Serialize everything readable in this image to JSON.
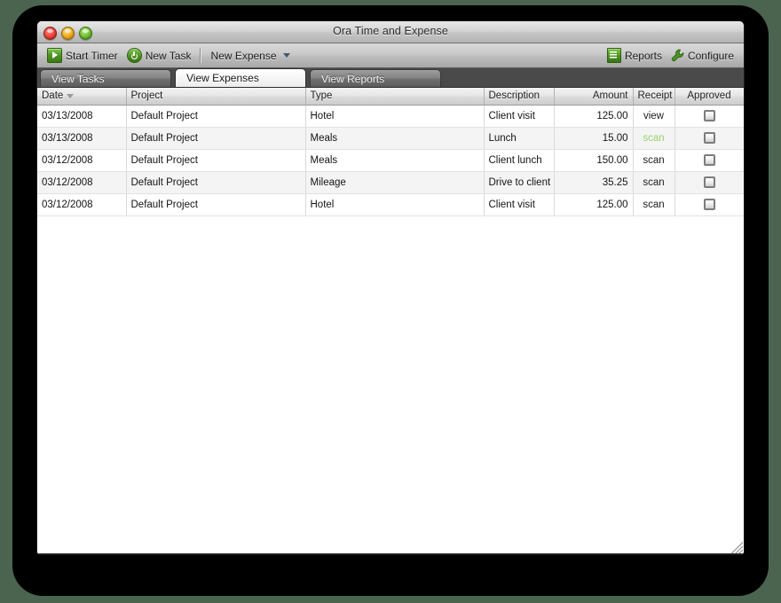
{
  "window": {
    "title": "Ora Time and Expense",
    "controls": [
      {
        "name": "close",
        "color": "#e8433a"
      },
      {
        "name": "minimize",
        "color": "#f0a81e"
      },
      {
        "name": "zoom",
        "color": "#6cbb32"
      }
    ]
  },
  "toolbar": {
    "start_timer_label": "Start Timer",
    "new_task_label": "New Task",
    "new_expense_label": "New Expense",
    "reports_label": "Reports",
    "configure_label": "Configure"
  },
  "tabs": [
    {
      "label": "View Tasks",
      "active": false
    },
    {
      "label": "View Expenses",
      "active": true
    },
    {
      "label": "View Reports",
      "active": false
    }
  ],
  "table": {
    "sort_column": "Date",
    "sort_direction": "descending",
    "columns": [
      {
        "label": "Date",
        "align": "left"
      },
      {
        "label": "Project",
        "align": "left"
      },
      {
        "label": "Type",
        "align": "left"
      },
      {
        "label": "Description",
        "align": "left"
      },
      {
        "label": "Amount",
        "align": "right"
      },
      {
        "label": "Receipt",
        "align": "center"
      },
      {
        "label": "Approved",
        "align": "center"
      }
    ],
    "rows": [
      {
        "date": "03/13/2008",
        "project": "Default Project",
        "type": "Hotel",
        "description": "Client visit",
        "amount": "125.00",
        "receipt": "view",
        "receipt_highlighted": false,
        "approved": false
      },
      {
        "date": "03/13/2008",
        "project": "Default Project",
        "type": "Meals",
        "description": "Lunch",
        "amount": "15.00",
        "receipt": "scan",
        "receipt_highlighted": true,
        "approved": false
      },
      {
        "date": "03/12/2008",
        "project": "Default Project",
        "type": "Meals",
        "description": "Client lunch",
        "amount": "150.00",
        "receipt": "scan",
        "receipt_highlighted": false,
        "approved": false
      },
      {
        "date": "03/12/2008",
        "project": "Default Project",
        "type": "Mileage",
        "description": "Drive to client",
        "amount": "35.25",
        "receipt": "scan",
        "receipt_highlighted": false,
        "approved": false
      },
      {
        "date": "03/12/2008",
        "project": "Default Project",
        "type": "Hotel",
        "description": "Client visit",
        "amount": "125.00",
        "receipt": "scan",
        "receipt_highlighted": false,
        "approved": false
      }
    ]
  },
  "colors": {
    "backdrop": "#4a6450",
    "frame": "#000000",
    "tabstrip": "#4a4a4a",
    "accent_green": "#4e9321",
    "link_highlight": "#9ccf6e"
  }
}
